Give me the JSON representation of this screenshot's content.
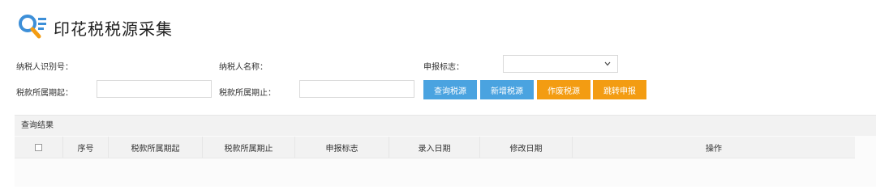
{
  "header": {
    "title": "印花税税源采集",
    "logo_icon": "search-list-icon"
  },
  "form": {
    "taxpayer_id_label": "纳税人识别号：",
    "taxpayer_name_label": "纳税人名称：",
    "declare_flag_label": "申报标志：",
    "declare_flag_value": "",
    "period_start_label": "税款所属期起：",
    "period_start_value": "",
    "period_end_label": "税款所属期止：",
    "period_end_value": ""
  },
  "buttons": {
    "query": "查询税源",
    "add": "新增税源",
    "void": "作废税源",
    "jump": "跳转申报"
  },
  "results": {
    "title": "查询结果",
    "columns": [
      "序号",
      "税款所属期起",
      "税款所属期止",
      "申报标志",
      "录入日期",
      "修改日期",
      "操作"
    ]
  },
  "colors": {
    "blue": "#4aa3e0",
    "orange": "#f39c12"
  }
}
